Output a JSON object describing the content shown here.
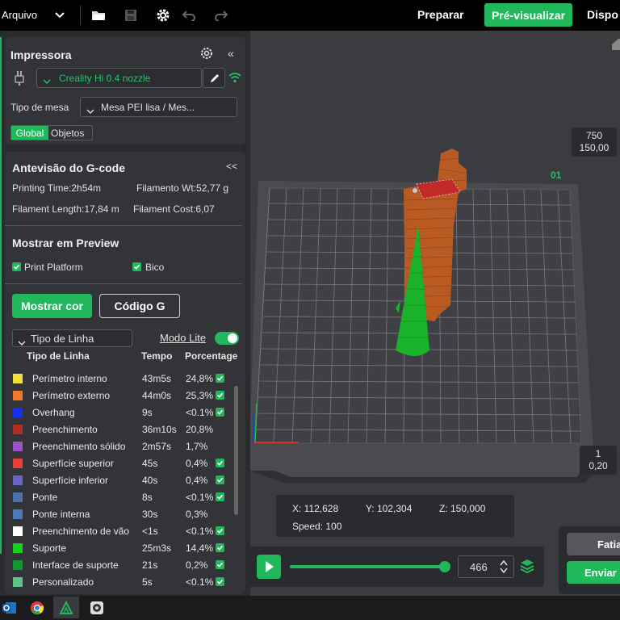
{
  "topbar": {
    "file_menu": "Arquivo",
    "nav_prepare": "Preparar",
    "nav_preview": "Pré-visualizar",
    "nav_device": "Dispo"
  },
  "printer": {
    "title": "Impressora",
    "collapse": "«",
    "printer_name": "Creality Hi 0.4 nozzle",
    "bed_label": "Tipo de mesa",
    "bed_value": "Mesa PEI lisa / Mes...",
    "tab_global": "Global",
    "tab_objects": "Objetos"
  },
  "gcode": {
    "title": "Antevisão do G-code",
    "collapse": "<<",
    "printing_time": "Printing Time:2h54m",
    "filament_wt": "Filamento Wt:52,77 g",
    "filament_length": "Filament Length:17,84 m",
    "filament_cost": "Filament Cost:6,07",
    "show_title": "Mostrar em Preview",
    "print_platform": "Print Platform",
    "nozzle": "Bico",
    "show_color_btn": "Mostrar cor",
    "gcode_btn": "Código G",
    "line_type_select": "Tipo de Linha",
    "lite_mode": "Modo Lite",
    "col_type": "Tipo de Linha",
    "col_time": "Tempo",
    "col_percent": "Porcentage",
    "rows": [
      {
        "name": "Perímetro interno",
        "time": "43m5s",
        "percent": "24,8%",
        "color": "#f5de3e",
        "checked": true
      },
      {
        "name": "Perímetro externo",
        "time": "44m0s",
        "percent": "25,3%",
        "color": "#f0782a",
        "checked": true
      },
      {
        "name": "Overhang",
        "time": "9s",
        "percent": "<0.1%",
        "color": "#1a2ff0",
        "checked": true
      },
      {
        "name": "Preenchimento",
        "time": "36m10s",
        "percent": "20,8%",
        "color": "#b02a26",
        "checked": false
      },
      {
        "name": "Preenchimento sólido",
        "time": "2m57s",
        "percent": "1,7%",
        "color": "#9a52c4",
        "checked": false
      },
      {
        "name": "Superfície superior",
        "time": "45s",
        "percent": "0,4%",
        "color": "#e8403e",
        "checked": true
      },
      {
        "name": "Superfície inferior",
        "time": "40s",
        "percent": "0,4%",
        "color": "#6a63c4",
        "checked": true
      },
      {
        "name": "Ponte",
        "time": "8s",
        "percent": "<0.1%",
        "color": "#4f6fa8",
        "checked": true
      },
      {
        "name": "Ponte interna",
        "time": "30s",
        "percent": "0,3%",
        "color": "#4a7ab8",
        "checked": false
      },
      {
        "name": "Preenchimento de vão",
        "time": "<1s",
        "percent": "<0.1%",
        "color": "#ffffff",
        "checked": true
      },
      {
        "name": "Suporte",
        "time": "25m3s",
        "percent": "14,4%",
        "color": "#14d21c",
        "checked": true
      },
      {
        "name": "Interface de suporte",
        "time": "21s",
        "percent": "0,2%",
        "color": "#0f9a2c",
        "checked": true
      },
      {
        "name": "Personalizado",
        "time": "5s",
        "percent": "<0.1%",
        "color": "#5ec48a",
        "checked": true
      }
    ]
  },
  "viewport": {
    "layer_top_height": "750",
    "layer_top_z": "150,00",
    "layer_bottom_height": "1",
    "layer_bottom_z": "0,20",
    "plate_label": "01",
    "coord_x": "X: 112,628",
    "coord_y": "Y: 102,304",
    "coord_z": "Z: 150,000",
    "speed": "Speed: 100",
    "move_value": "466",
    "move_progress": 0.99,
    "slice_btn": "Fatia",
    "send_btn": "Enviar i"
  }
}
